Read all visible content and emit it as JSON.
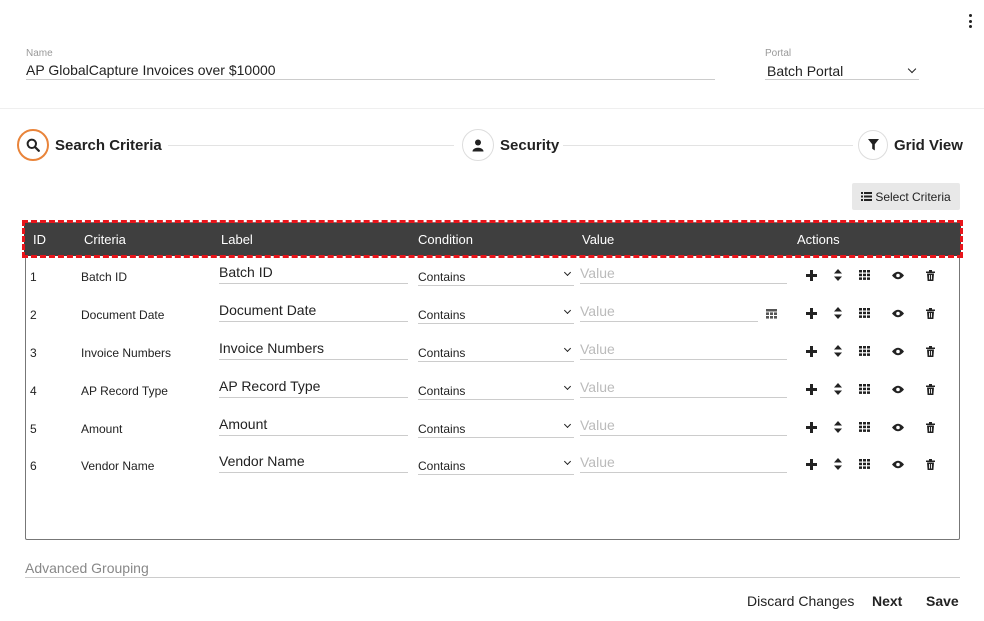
{
  "header": {
    "name_label": "Name",
    "name_value": "AP GlobalCapture Invoices over $10000",
    "portal_label": "Portal",
    "portal_value": "Batch Portal"
  },
  "steps": [
    {
      "label": "Search Criteria",
      "icon": "search-icon",
      "active": true
    },
    {
      "label": "Security",
      "icon": "user-icon",
      "active": false
    },
    {
      "label": "Grid View",
      "icon": "filter-icon",
      "active": false
    }
  ],
  "select_criteria_label": "Select Criteria",
  "table": {
    "columns": [
      "ID",
      "Criteria",
      "Label",
      "Condition",
      "Value",
      "Actions"
    ],
    "rows": [
      {
        "id": "1",
        "criteria": "Batch ID",
        "label": "Batch ID",
        "condition": "Contains",
        "value_placeholder": "Value"
      },
      {
        "id": "2",
        "criteria": "Document Date",
        "label": "Document Date",
        "condition": "Contains",
        "value_placeholder": "Value"
      },
      {
        "id": "3",
        "criteria": "Invoice Numbers",
        "label": "Invoice Numbers",
        "condition": "Contains",
        "value_placeholder": "Value"
      },
      {
        "id": "4",
        "criteria": "AP Record Type",
        "label": "AP Record Type",
        "condition": "Contains",
        "value_placeholder": "Value"
      },
      {
        "id": "5",
        "criteria": "Amount",
        "label": "Amount",
        "condition": "Contains",
        "value_placeholder": "Value"
      },
      {
        "id": "6",
        "criteria": "Vendor Name",
        "label": "Vendor Name",
        "condition": "Contains",
        "value_placeholder": "Value"
      }
    ],
    "row_actions": [
      "plus-icon",
      "sort-icon",
      "grid-icon",
      "eye-icon",
      "trash-icon"
    ]
  },
  "advanced_grouping_label": "Advanced Grouping",
  "footer": {
    "discard_label": "Discard Changes",
    "next_label": "Next",
    "save_label": "Save"
  },
  "colors": {
    "accent": "#e9843a",
    "header_bg": "#3f3f3f",
    "highlight": "#e8151b"
  }
}
